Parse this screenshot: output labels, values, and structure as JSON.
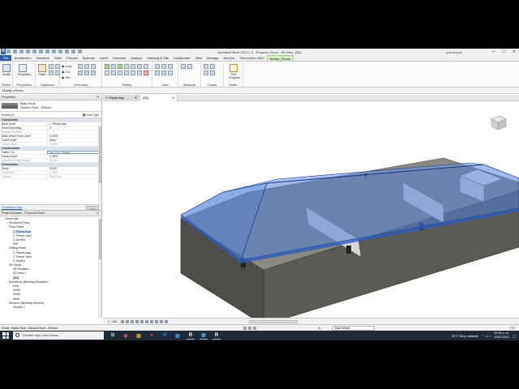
{
  "window": {
    "title": "Autodesk Revit 2021.1.3 - Proyecto Techo - 3D View: {3D}",
    "user": "jrivera.jane"
  },
  "ribbon": {
    "tabs": [
      "File",
      "Architecture",
      "Structure",
      "Steel",
      "Precast",
      "Systems",
      "Insert",
      "Annotate",
      "Analyze",
      "Massing & Site",
      "Collaborate",
      "View",
      "Manage",
      "Add-Ins",
      "Twinmotion 2020",
      "Modify | Roofs"
    ],
    "active_tab": "Modify | Roofs",
    "groups": {
      "select": "Select",
      "properties": "Properties",
      "clipboard": "Clipboard",
      "geometry": "Geometry",
      "modify": "Modify",
      "view": "View",
      "measure": "Measure",
      "create": "Create",
      "mode": "Mode"
    },
    "buttons": {
      "modify": "Modify",
      "properties": "Properties",
      "paste": "Paste",
      "cope": "Cope",
      "cut": "Cut",
      "join": "Join",
      "edit_footprint": "Edit Footprint"
    }
  },
  "context_bar": "Modify | Roofs",
  "properties": {
    "header": "Properties",
    "type_family": "Basic Roof",
    "type_name": "Generic Roof - 200mm",
    "instance_filter": "Roofs (1)",
    "edit_type": "Edit Type",
    "sections": [
      {
        "name": "Constraints",
        "rows": [
          {
            "k": "Base Level",
            "v": "1. Planta baja",
            "dim": false
          },
          {
            "k": "Room Bounding",
            "v": "☑",
            "dim": false
          },
          {
            "k": "Related to Mass",
            "v": "",
            "dim": true
          },
          {
            "k": "Base Offset From Level",
            "v": "3,0000",
            "dim": false
          },
          {
            "k": "Cutoff Level",
            "v": "None",
            "dim": false
          },
          {
            "k": "Cutoff Offset",
            "v": "0,0000",
            "dim": true
          }
        ]
      },
      {
        "name": "Construction",
        "rows": [
          {
            "k": "Rafter Cut",
            "v": "Two Cut - Plumb",
            "dim": false,
            "boxed": true
          },
          {
            "k": "Fascia Depth",
            "v": "0,0000",
            "dim": false
          },
          {
            "k": "Maximum Ridge Height",
            "v": "5,1444",
            "dim": true
          }
        ]
      },
      {
        "name": "Dimensions",
        "rows": [
          {
            "k": "Slope",
            "v": "30,00°",
            "dim": false
          },
          {
            "k": "Thickness",
            "v": "0,2000",
            "dim": true
          },
          {
            "k": "Volume",
            "v": "26,124 m³",
            "dim": true
          }
        ]
      }
    ],
    "help_link": "Properties help",
    "apply": "Apply"
  },
  "browser": {
    "header": "Project Browser - Proyecto Techo",
    "tree": [
      {
        "label": "Views (all)",
        "level": 0,
        "tw": "−"
      },
      {
        "label": "Structural Plans",
        "level": 1,
        "tw": "+"
      },
      {
        "label": "Floor Plans",
        "level": 1,
        "tw": "−"
      },
      {
        "label": "1. Planta baja",
        "level": 2,
        "tw": "",
        "sel": true
      },
      {
        "label": "2. Primer nivel",
        "level": 2,
        "tw": ""
      },
      {
        "label": "3. Azotea",
        "level": 2,
        "tw": ""
      },
      {
        "label": "Site",
        "level": 2,
        "tw": ""
      },
      {
        "label": "Ceiling Plans",
        "level": 1,
        "tw": "−"
      },
      {
        "label": "1. Planta baja",
        "level": 2,
        "tw": ""
      },
      {
        "label": "2. Primer nivel",
        "level": 2,
        "tw": ""
      },
      {
        "label": "3. Azotea",
        "level": 2,
        "tw": ""
      },
      {
        "label": "3D Views",
        "level": 1,
        "tw": "−"
      },
      {
        "label": "3D Escalera",
        "level": 2,
        "tw": ""
      },
      {
        "label": "3D View 1",
        "level": 2,
        "tw": ""
      },
      {
        "label": "{3D}",
        "level": 2,
        "tw": "",
        "bold": true
      },
      {
        "label": "Elevations (Building Elevation)",
        "level": 1,
        "tw": "−"
      },
      {
        "label": "East",
        "level": 2,
        "tw": ""
      },
      {
        "label": "North",
        "level": 2,
        "tw": ""
      },
      {
        "label": "South",
        "level": 2,
        "tw": ""
      },
      {
        "label": "West",
        "level": 2,
        "tw": ""
      },
      {
        "label": "Sections (Building Section)",
        "level": 1,
        "tw": "−"
      },
      {
        "label": "Section 1",
        "level": 2,
        "tw": ""
      }
    ]
  },
  "view_tabs": [
    {
      "label": "1. Planta baja",
      "active": false
    },
    {
      "label": "{3D}",
      "active": true
    }
  ],
  "view_bar": {
    "scale": "1 : 100"
  },
  "status_bar": {
    "message": "Roofs : Basic Roof : Generic Roof - 200mm",
    "zero": ":0",
    "model": "Main Model"
  },
  "taskbar": {
    "search_placeholder": "Escribe aquí para buscar",
    "weather": "22°C  Muy nublado",
    "time": "09:46 a. m.",
    "date": "16/11/2021",
    "apps": [
      "⧉",
      "◉",
      "▤",
      "●",
      "W",
      "▦",
      "R",
      "▣",
      "R"
    ]
  },
  "colors": {
    "roof_glass": "#4f7fd8",
    "wall_fill": "#5b5b56",
    "active_tab": "#d6efc8",
    "file_tab": "#2f5ea8"
  }
}
